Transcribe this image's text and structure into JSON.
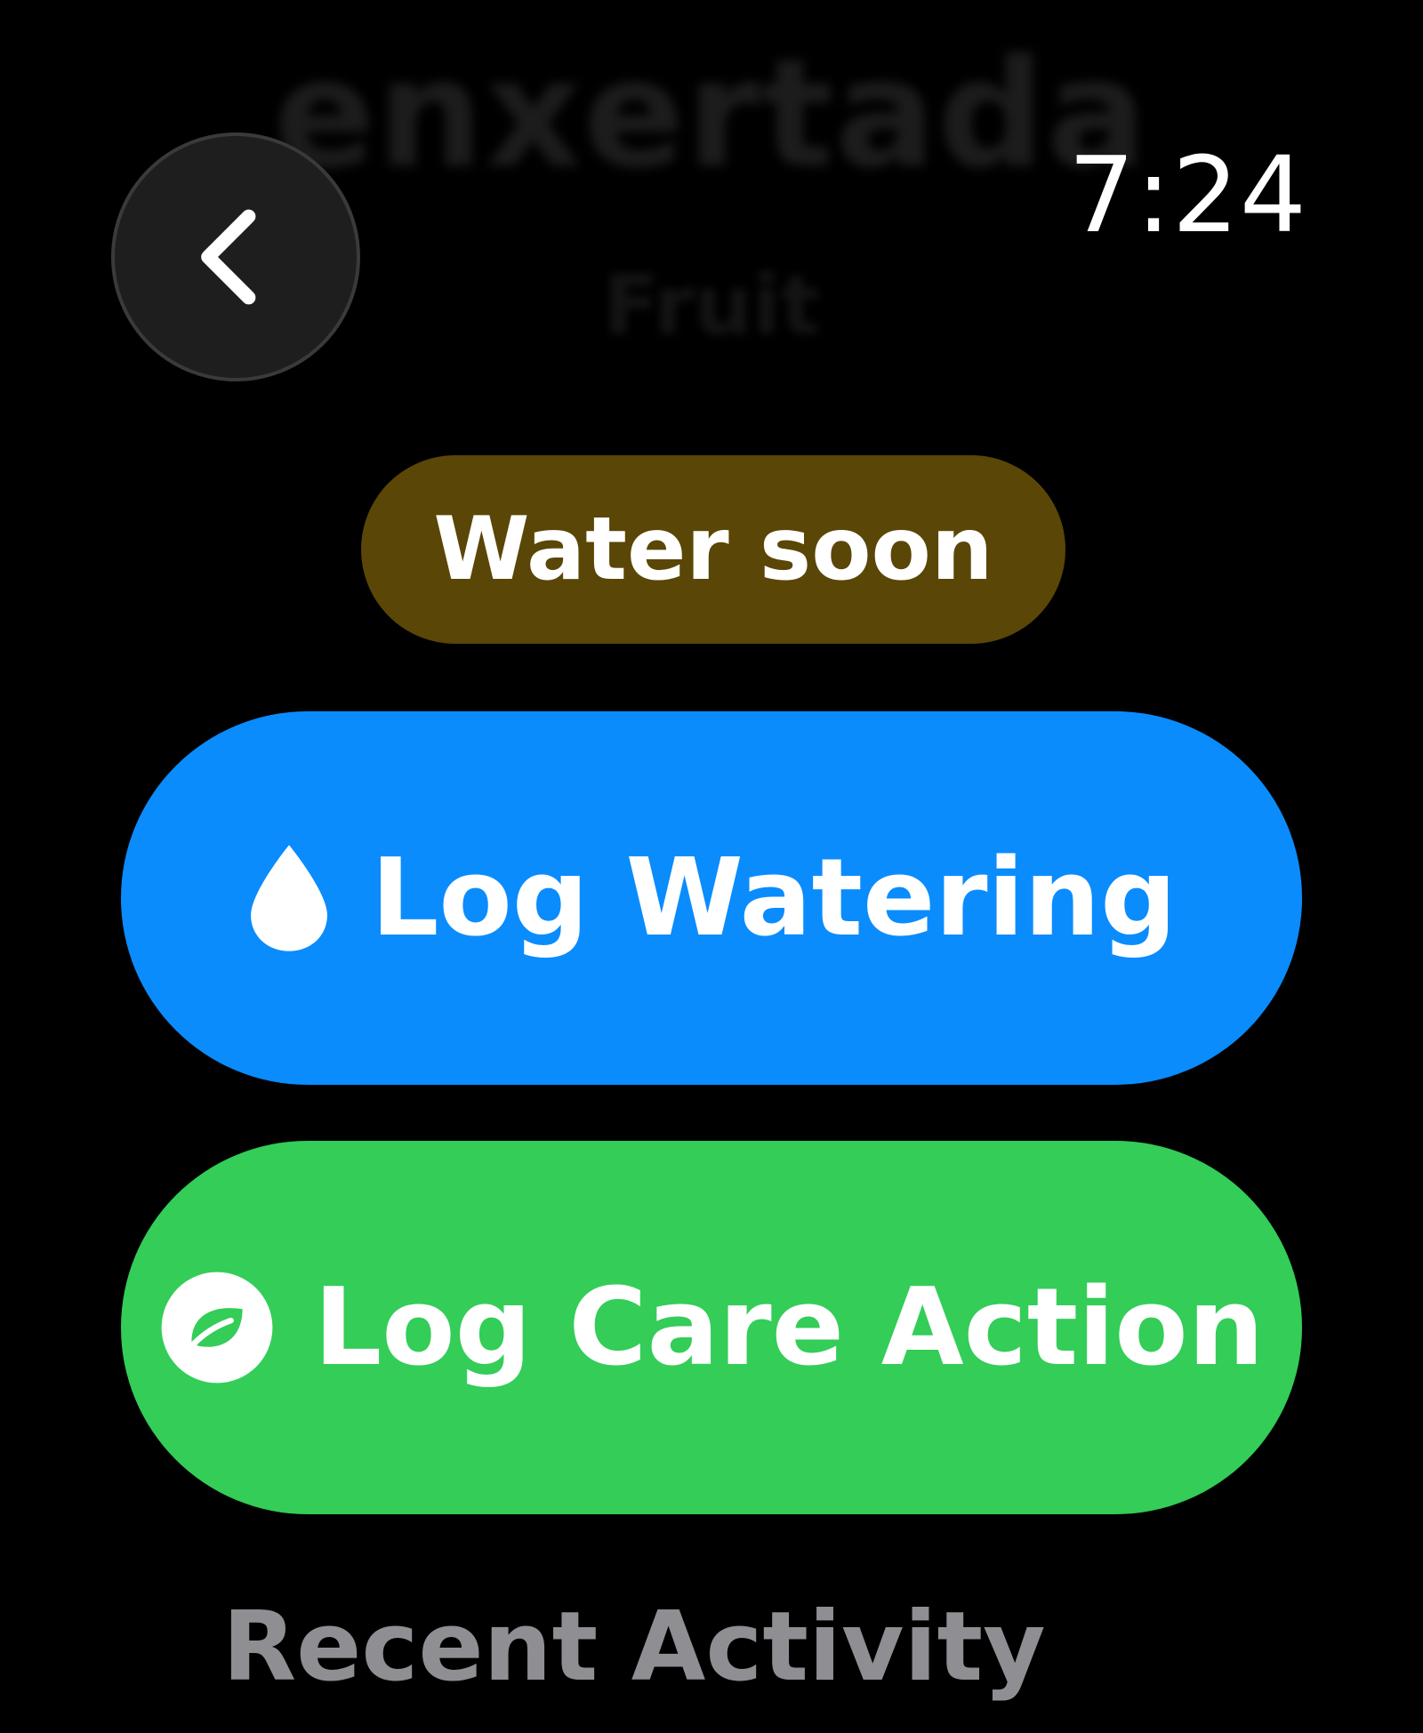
{
  "header": {
    "plant_name": "enxertada",
    "plant_category": "Fruit",
    "time": "7:24"
  },
  "navigation": {
    "back_icon": "chevron-left-icon"
  },
  "status": {
    "label": "Water soon",
    "color": "#5a4606"
  },
  "actions": {
    "water": {
      "label": "Log Watering",
      "icon": "water-drop-icon",
      "color": "#0a8cfd"
    },
    "care": {
      "label": "Log Care Action",
      "icon": "leaf-circle-icon",
      "color": "#33cd58"
    }
  },
  "recent_activity": {
    "heading": "Recent Activity"
  }
}
